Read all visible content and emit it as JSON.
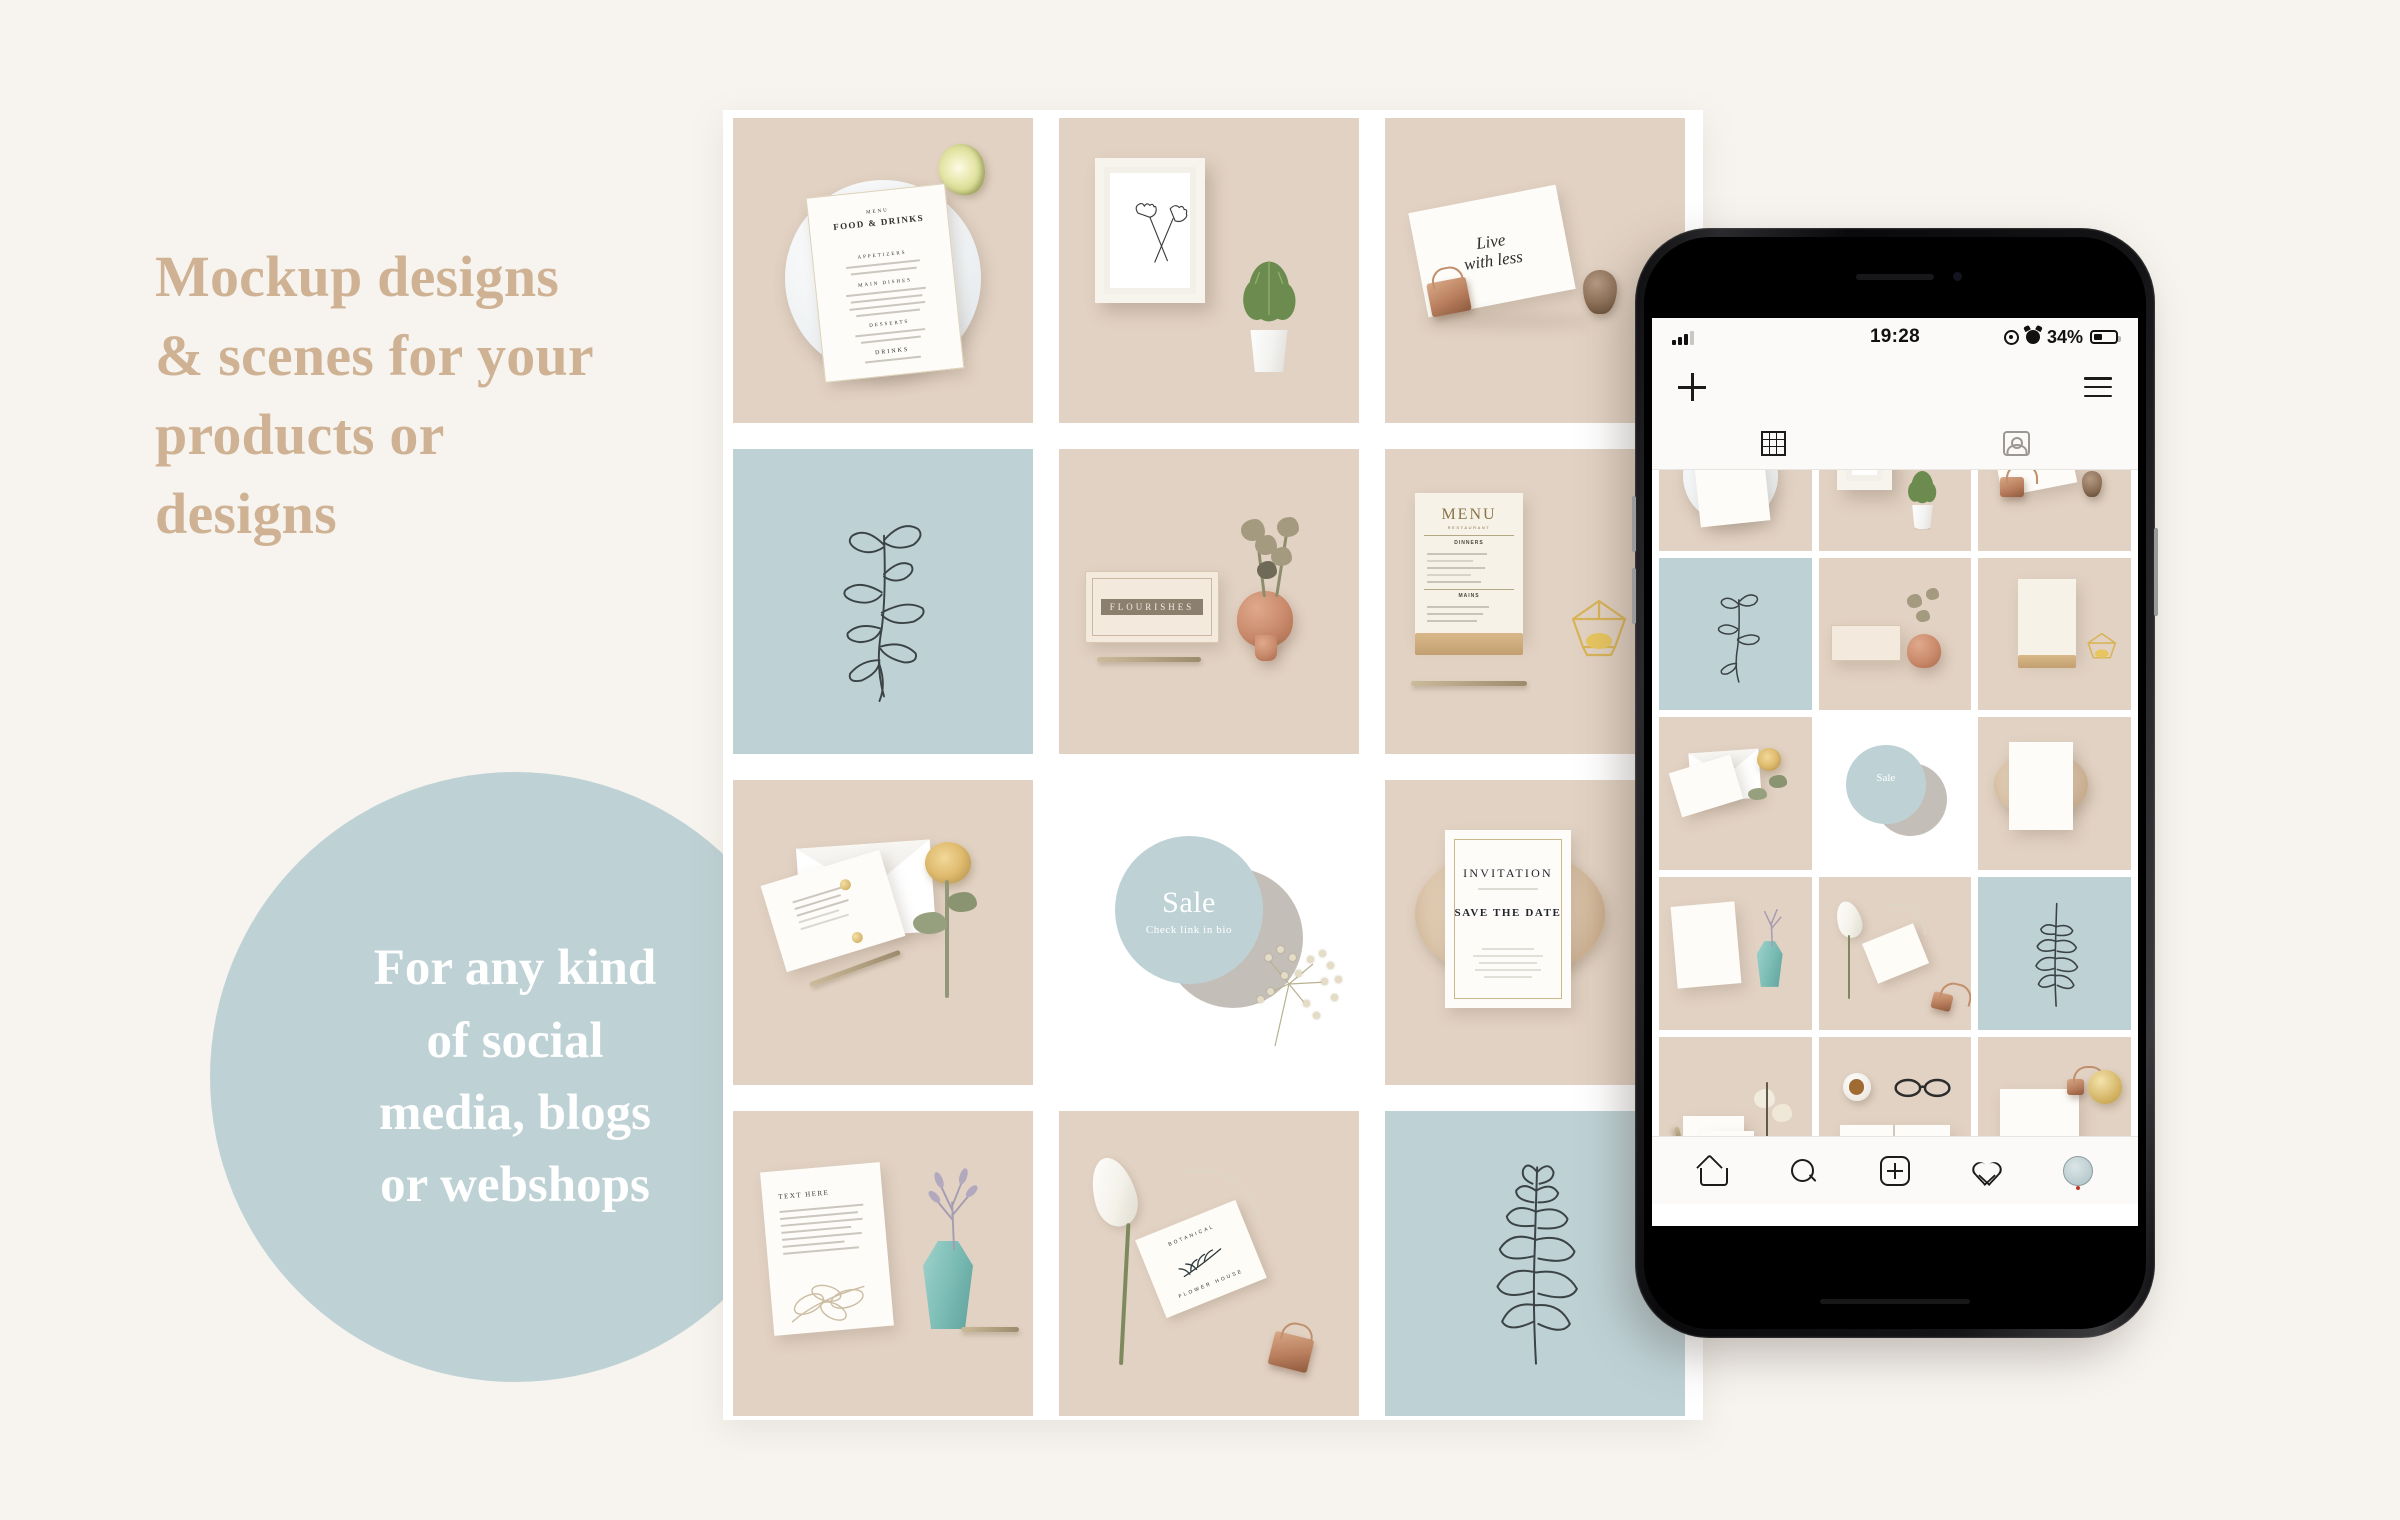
{
  "theme": {
    "background": "#f7f4ef",
    "accent_tan": "#cfb294",
    "accent_sage": "#bed2d6",
    "tile_beige": "#e2d2c3",
    "white": "#ffffff",
    "ink": "#1b1b1b"
  },
  "headline": {
    "lines": [
      "Mockup designs",
      "& scenes for your",
      "products or",
      "designs"
    ]
  },
  "circle_badge": {
    "lines": [
      "For any kind",
      "of social",
      "media, blogs",
      "or webshops"
    ]
  },
  "grid": {
    "tiles": [
      {
        "id": "tile-menu-plate",
        "bg": "beige",
        "caption": "FOOD & DRINKS",
        "sub": "MENU",
        "sections": [
          "APPETIZERS",
          "MAIN DISHES",
          "DESSERTS",
          "DRINKS"
        ]
      },
      {
        "id": "tile-framed-print",
        "bg": "beige",
        "caption": "",
        "sub": ""
      },
      {
        "id": "tile-live-with-less",
        "bg": "beige",
        "caption": "Live with less",
        "sub": ""
      },
      {
        "id": "tile-botanical-sage-1",
        "bg": "sage",
        "caption": "",
        "sub": ""
      },
      {
        "id": "tile-flourishes-card",
        "bg": "beige",
        "caption": "FLOURISHES",
        "sub": ""
      },
      {
        "id": "tile-restaurant-menu",
        "bg": "beige",
        "caption": "MENU",
        "sub": "RESTAURANT",
        "sections": [
          "DINNERS",
          "MAINS"
        ]
      },
      {
        "id": "tile-envelope-rose",
        "bg": "beige",
        "caption": "",
        "sub": ""
      },
      {
        "id": "tile-sale",
        "bg": "white",
        "caption": "Sale",
        "sub": "Check link in bio"
      },
      {
        "id": "tile-invitation",
        "bg": "beige",
        "caption": "INVITATION",
        "sub": "SAVE THE DATE"
      },
      {
        "id": "tile-poster-vase",
        "bg": "beige",
        "caption": "TEXT HERE",
        "sub": ""
      },
      {
        "id": "tile-lily-tag",
        "bg": "beige",
        "caption": "BOTANICAL",
        "sub": "FLOWER HOUSE"
      },
      {
        "id": "tile-botanical-sage-2",
        "bg": "sage",
        "caption": "",
        "sub": ""
      }
    ]
  },
  "phone": {
    "status_bar": {
      "time": "19:28",
      "battery_percent": "34%",
      "signal_icon": "signal-bars-icon",
      "location_icon": "location-icon",
      "alarm_icon": "alarm-icon",
      "battery_icon": "battery-icon"
    },
    "header": {
      "add_icon": "plus-icon",
      "menu_icon": "hamburger-menu-icon"
    },
    "tabs": [
      {
        "id": "tab-grid",
        "icon": "grid-icon"
      },
      {
        "id": "tab-tagged",
        "icon": "tagged-person-icon"
      }
    ],
    "nav": [
      {
        "id": "nav-home",
        "icon": "home-icon"
      },
      {
        "id": "nav-search",
        "icon": "search-icon"
      },
      {
        "id": "nav-add",
        "icon": "add-post-icon"
      },
      {
        "id": "nav-activity",
        "icon": "heart-icon"
      },
      {
        "id": "nav-profile",
        "icon": "avatar-icon"
      }
    ],
    "grid_cells": [
      {
        "id": "pcell-menu-plate",
        "bg": "beige"
      },
      {
        "id": "pcell-framed-print",
        "bg": "beige"
      },
      {
        "id": "pcell-live-with-less",
        "bg": "beige"
      },
      {
        "id": "pcell-botanical-sage-1",
        "bg": "sage"
      },
      {
        "id": "pcell-flourishes-card",
        "bg": "beige"
      },
      {
        "id": "pcell-restaurant-menu",
        "bg": "beige"
      },
      {
        "id": "pcell-envelope-rose",
        "bg": "beige"
      },
      {
        "id": "pcell-sale",
        "bg": "white"
      },
      {
        "id": "pcell-invitation",
        "bg": "beige"
      },
      {
        "id": "pcell-poster-vase",
        "bg": "beige"
      },
      {
        "id": "pcell-lily-tag",
        "bg": "beige"
      },
      {
        "id": "pcell-botanical-sage-2",
        "bg": "sage"
      },
      {
        "id": "pcell-cards-flowers",
        "bg": "beige"
      },
      {
        "id": "pcell-book-coffee",
        "bg": "beige"
      },
      {
        "id": "pcell-letterhead-cup",
        "bg": "beige"
      }
    ],
    "sale_label": "Sale"
  }
}
